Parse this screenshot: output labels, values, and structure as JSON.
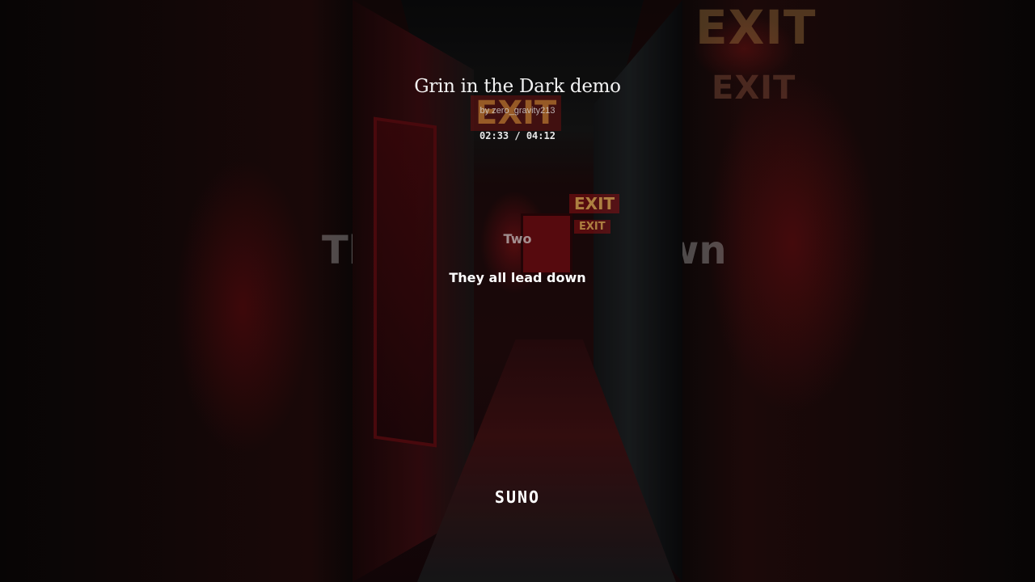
{
  "song": {
    "title": "Grin in the Dark demo",
    "artist": "by zero_gravity213",
    "time": "02:33 / 04:12"
  },
  "lyrics": {
    "previous": "Two",
    "current": "They all lead down",
    "ghost_left": "Th",
    "ghost_right": "wn"
  },
  "brand": {
    "name": "SUNO"
  },
  "signs": {
    "exit_text": "EXIT"
  },
  "colors": {
    "accent_red": "#a0141a",
    "text": "#ffffff"
  }
}
